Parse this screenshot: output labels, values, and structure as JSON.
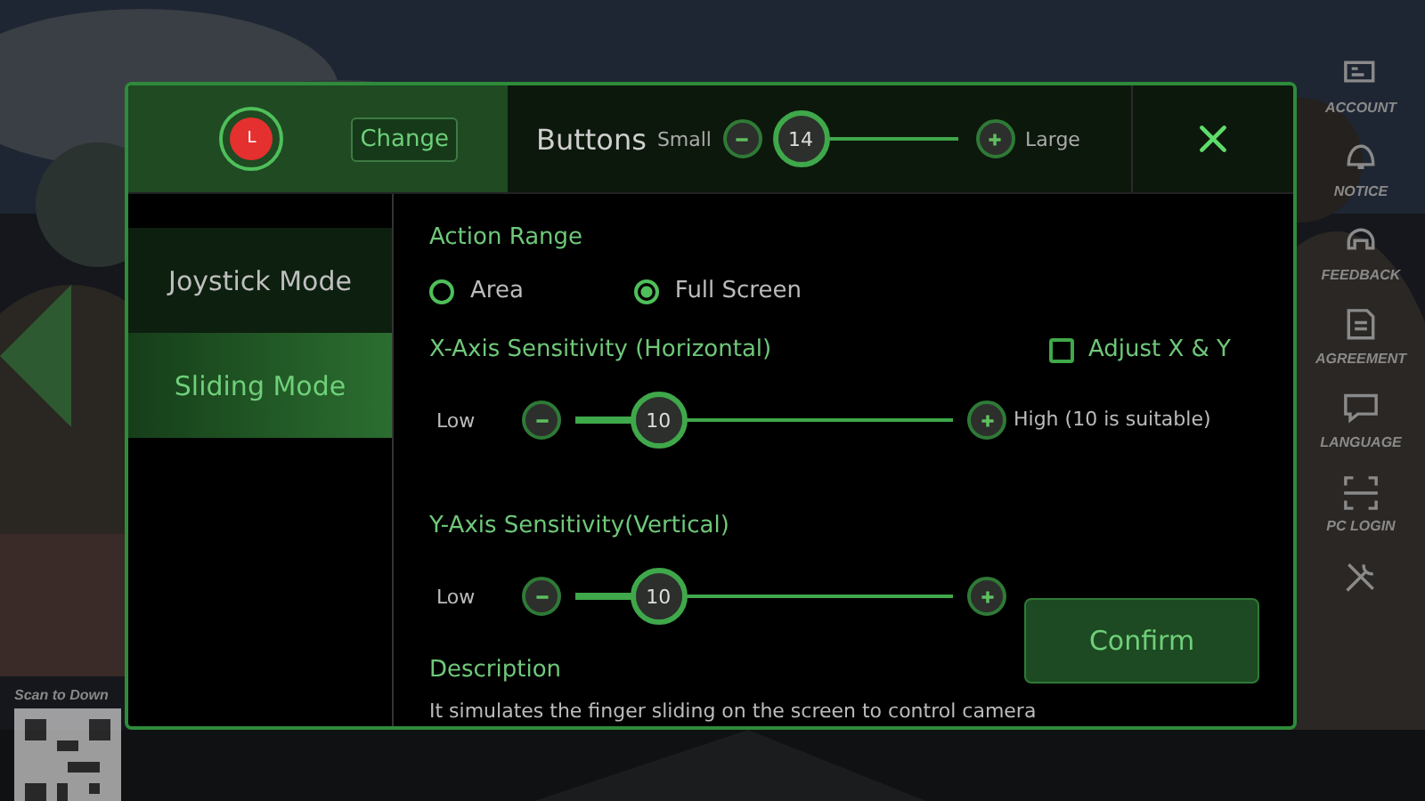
{
  "background": {
    "kind": "picture",
    "qr_caption": "Scan to Down",
    "side_menu": [
      {
        "label": "ACCOUNT"
      },
      {
        "label": "NOTICE"
      },
      {
        "label": "FEEDBACK"
      },
      {
        "label": "AGREEMENT"
      },
      {
        "label": "LANGUAGE"
      },
      {
        "label": "PC LOGIN"
      }
    ]
  },
  "dialog": {
    "header": {
      "key_label": "L",
      "change_button": "Change",
      "buttons_label": "Buttons",
      "size_slider": {
        "min_label": "Small",
        "value": "14",
        "level": 0.12,
        "max_label": "Large"
      }
    },
    "modes": [
      {
        "label": "Joystick Mode",
        "selected": false
      },
      {
        "label": "Sliding Mode",
        "selected": true
      }
    ],
    "action_range": {
      "title": "Action Range",
      "options": [
        {
          "label": "Area",
          "selected": false
        },
        {
          "label": "Full Screen",
          "selected": true
        }
      ]
    },
    "x_axis": {
      "title": "X-Axis Sensitivity (Horizontal)",
      "min_label": "Low",
      "value": "10",
      "level": 0.22,
      "max_label": "High (10 is suitable)"
    },
    "adjust_xy": {
      "label": "Adjust X & Y",
      "checked": false
    },
    "y_axis": {
      "title": "Y-Axis Sensitivity(Vertical)",
      "min_label": "Low",
      "value": "10",
      "level": 0.22
    },
    "description": {
      "title": "Description",
      "text": "It simulates the finger sliding on the screen to control camera"
    },
    "confirm_button": "Confirm"
  }
}
